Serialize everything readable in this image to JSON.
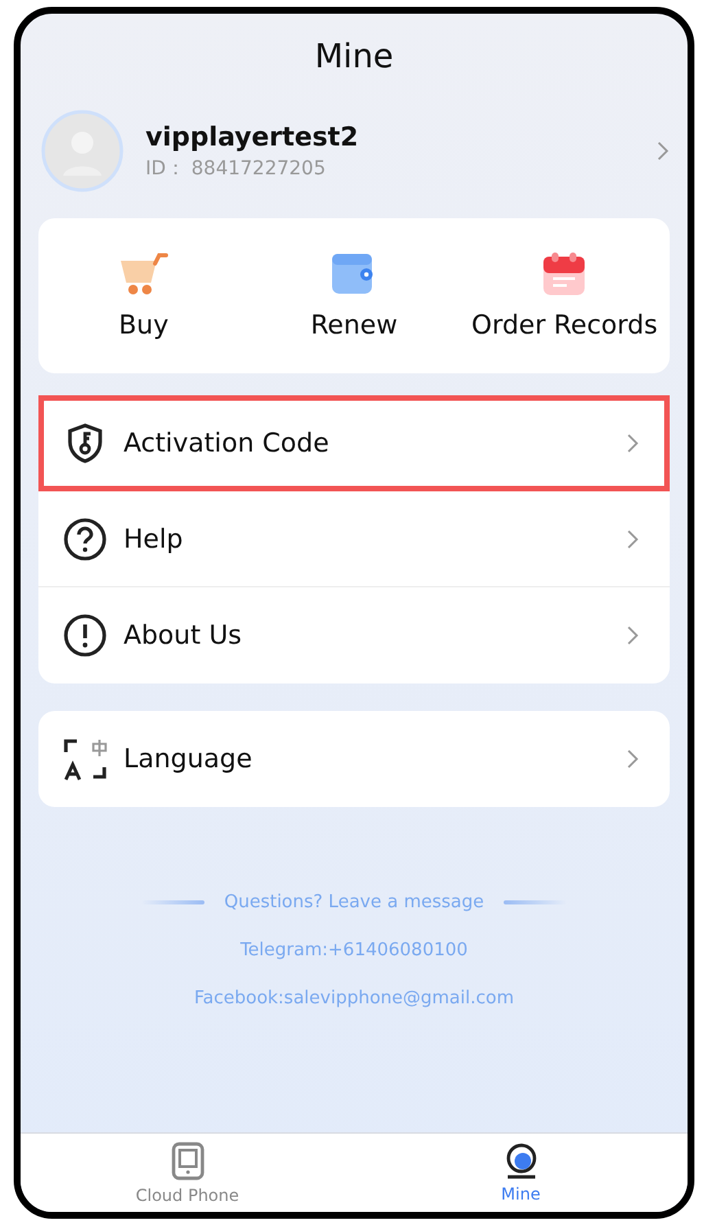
{
  "header": {
    "title": "Mine"
  },
  "profile": {
    "username": "vipplayertest2",
    "id_label": "ID：",
    "id_value": "88417227205"
  },
  "quick_actions": [
    {
      "kind": "cart",
      "label": "Buy"
    },
    {
      "kind": "wallet",
      "label": "Renew"
    },
    {
      "kind": "calendar",
      "label": "Order Records"
    }
  ],
  "menu": [
    {
      "kind": "shield",
      "label": "Activation Code",
      "highlighted": true
    },
    {
      "kind": "help",
      "label": "Help",
      "highlighted": false
    },
    {
      "kind": "about",
      "label": "About Us",
      "highlighted": false
    }
  ],
  "settings": [
    {
      "kind": "language",
      "label": "Language",
      "highlighted": false
    }
  ],
  "contact": {
    "heading": "Questions? Leave a message",
    "lines": [
      "Telegram:+61406080100",
      "Facebook:salevipphone@gmail.com"
    ]
  },
  "tab_bar": [
    {
      "kind": "phone",
      "label": "Cloud Phone",
      "selected": false
    },
    {
      "kind": "mine",
      "label": "Mine",
      "selected": true
    }
  ]
}
